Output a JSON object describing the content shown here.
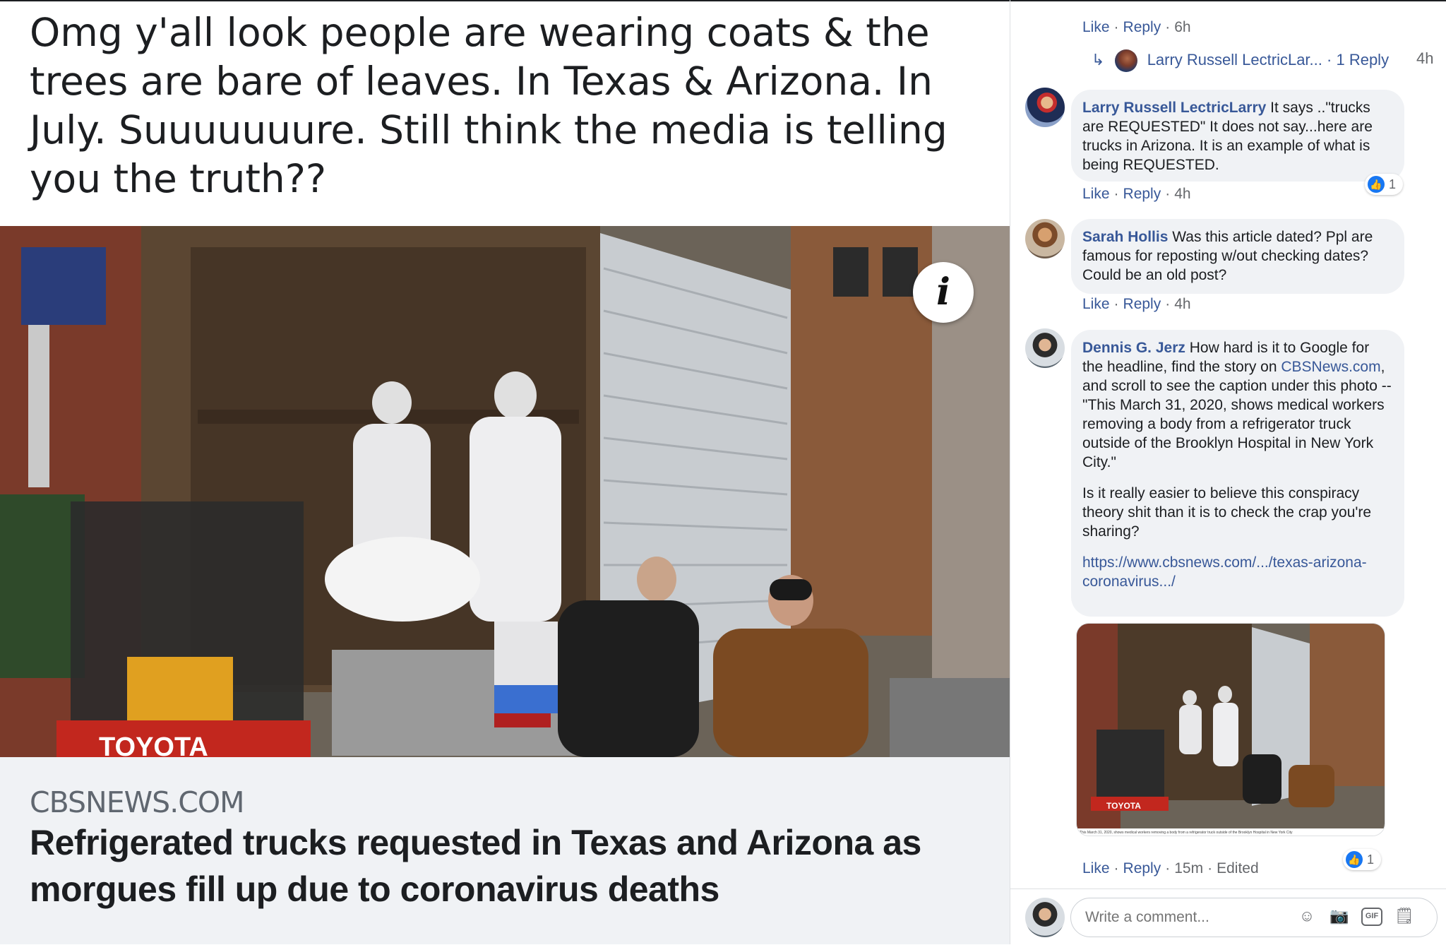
{
  "post": {
    "text": "Omg y'all look people are wearing coats & the trees are bare of leaves. In Texas & Arizona. In July. Suuuuuuure. Still think the media is telling you the truth??",
    "link_domain": "CBSNEWS.COM",
    "link_title": "Refrigerated trucks requested in Texas and Arizona as morgues fill up due to coronavirus deaths",
    "image_info_glyph": "i",
    "truck_brand_text": "TOYOTA"
  },
  "comments": {
    "top_actions": {
      "like": "Like",
      "reply": "Reply",
      "time": "6h"
    },
    "reply_thread": {
      "author": "Larry Russell LectricLar...",
      "replies": "1 Reply",
      "time": "4h"
    },
    "items": [
      {
        "author": "Larry Russell LectricLarry",
        "text": "It says ..\"trucks are REQUESTED\" It does not say...here are trucks in Arizona. It is an example of what is being REQUESTED.",
        "like": "Like",
        "reply": "Reply",
        "time": "4h",
        "reactions": "1"
      },
      {
        "author": "Sarah Hollis",
        "text": "Was this article dated? Ppl are famous for reposting w/out checking dates? Could be an old post?",
        "like": "Like",
        "reply": "Reply",
        "time": "4h"
      },
      {
        "author": "Dennis G. Jerz",
        "text_a": "How hard is it to Google for the headline, find the story on",
        "link_a": "CBSNews.com",
        "text_b": ", and scroll to see the caption under this photo -- \"This March 31, 2020, shows medical workers removing a body from a refrigerator truck outside of the Brooklyn Hospital in New York City.\"",
        "text_c": "Is it really easier to believe this conspiracy theory shit than it is to check the crap you're sharing?",
        "url": "https://www.cbsnews.com/.../texas-arizona-coronavirus.../",
        "like": "Like",
        "reply": "Reply",
        "time": "15m",
        "edited": "Edited",
        "reactions": "1",
        "image_caption": "This March 31, 2020, shows medical workers removing a body from a refrigerator truck outside of the Brooklyn Hospital in New York City",
        "image_brand_text": "TOYOTA"
      }
    ]
  },
  "composer": {
    "placeholder": "Write a comment...",
    "icons": [
      "emoji-icon",
      "camera-icon",
      "gif-icon",
      "sticker-icon"
    ],
    "gif_label": "GIF"
  },
  "colors": {
    "link": "#385898",
    "bubble": "#f0f2f5",
    "like_blue": "#1877f2",
    "meta": "#65676b"
  }
}
